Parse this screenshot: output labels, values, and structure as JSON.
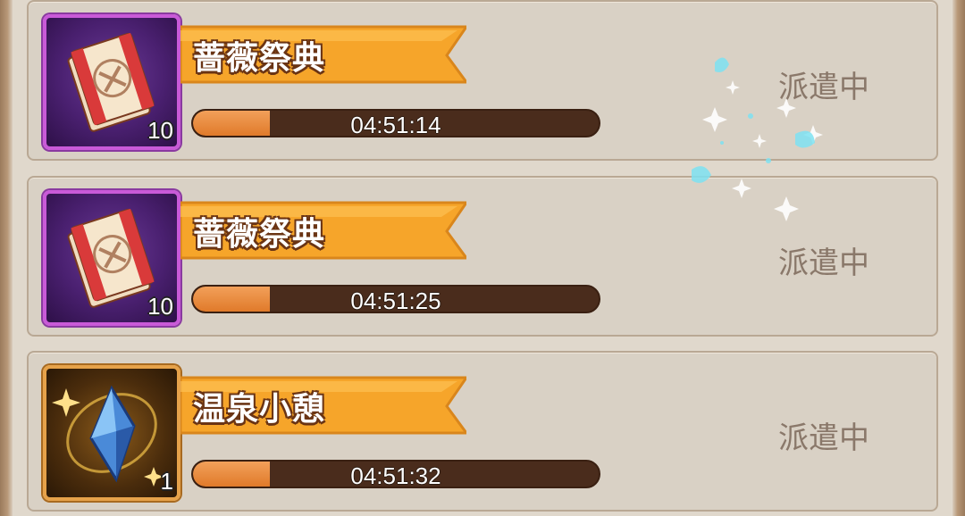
{
  "expeditions": [
    {
      "title": "蔷薇祭典",
      "item_icon": "rose-festival-ticket-icon",
      "item_count": "10",
      "timer": "04:51:14",
      "progress": 0.19,
      "status": "派遣中"
    },
    {
      "title": "蔷薇祭典",
      "item_icon": "rose-festival-ticket-icon",
      "item_count": "10",
      "timer": "04:51:25",
      "progress": 0.19,
      "status": "派遣中"
    },
    {
      "title": "温泉小憩",
      "item_icon": "blue-crystal-icon",
      "item_count": "1",
      "timer": "04:51:32",
      "progress": 0.19,
      "status": "派遣中"
    }
  ],
  "colors": {
    "banner": "#f6a52a",
    "progress_fill": "#e88a3a",
    "progress_track": "#4a2c1c",
    "status_text": "#8a786a"
  }
}
